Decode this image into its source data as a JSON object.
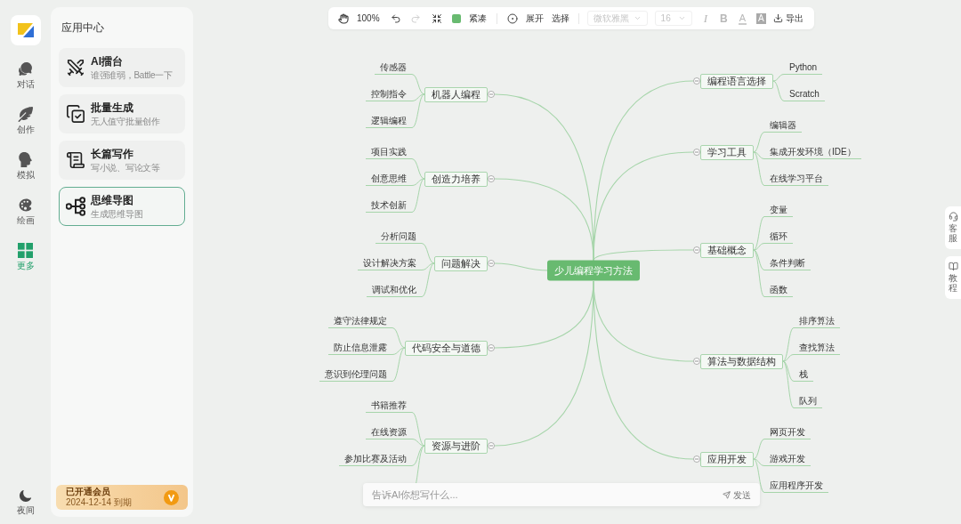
{
  "nav": {
    "items": [
      {
        "label": "对话",
        "selected": false
      },
      {
        "label": "创作",
        "selected": false
      },
      {
        "label": "模拟",
        "selected": false
      },
      {
        "label": "绘画",
        "selected": false
      },
      {
        "label": "更多",
        "selected": true
      }
    ],
    "night_mode": {
      "label": "夜间"
    }
  },
  "app_center": {
    "title": "应用中心",
    "apps": [
      {
        "title": "AI擂台",
        "subtitle": "谁强谁弱，Battle一下",
        "selected": false
      },
      {
        "title": "批量生成",
        "subtitle": "无人值守批量创作",
        "selected": false
      },
      {
        "title": "长篇写作",
        "subtitle": "写小说、写论文等",
        "selected": false
      },
      {
        "title": "思维导图",
        "subtitle": "生成思维导图",
        "selected": true
      }
    ],
    "membership": {
      "title": "已开通会员",
      "expiry": "2024-12-14 到期"
    }
  },
  "toolbar": {
    "zoom": "100%",
    "undo": {
      "disabled": false
    },
    "redo": {
      "disabled": true
    },
    "layout": "紧凑",
    "expand": "展开",
    "select": "选择",
    "font_family": {
      "value": "微软雅黑",
      "disabled": true
    },
    "font_size": {
      "value": "16",
      "disabled": true
    },
    "format_buttons": [
      {
        "kind": "italic",
        "label": "I",
        "disabled": true
      },
      {
        "kind": "bold",
        "label": "B",
        "disabled": true
      },
      {
        "kind": "font_color",
        "label": "A",
        "disabled": true
      },
      {
        "kind": "highlight",
        "label": "A",
        "disabled": true
      }
    ],
    "export": "导出"
  },
  "mind_map": {
    "root": "少儿编程学习方法",
    "left_branches": [
      {
        "label": "机器人编程",
        "expanded": true,
        "children": [
          {
            "label": "传感器"
          },
          {
            "label": "控制指令"
          },
          {
            "label": "逻辑编程"
          }
        ]
      },
      {
        "label": "创造力培养",
        "expanded": true,
        "children": [
          {
            "label": "项目实践"
          },
          {
            "label": "创意思维"
          },
          {
            "label": "技术创新"
          }
        ]
      },
      {
        "label": "问题解决",
        "expanded": true,
        "children": [
          {
            "label": "分析问题"
          },
          {
            "label": "设计解决方案"
          },
          {
            "label": "调试和优化"
          }
        ]
      },
      {
        "label": "代码安全与道德",
        "expanded": true,
        "children": [
          {
            "label": "遵守法律规定"
          },
          {
            "label": "防止信息泄露"
          },
          {
            "label": "意识到伦理问题"
          }
        ]
      },
      {
        "label": "资源与进阶",
        "expanded": true,
        "continues_below": true,
        "children": [
          {
            "label": "书籍推荐"
          },
          {
            "label": "在线资源"
          },
          {
            "label": "参加比赛及活动"
          }
        ]
      }
    ],
    "right_branches": [
      {
        "label": "编程语言选择",
        "expanded": true,
        "children": [
          {
            "label": "Python"
          },
          {
            "label": "Scratch"
          }
        ]
      },
      {
        "label": "学习工具",
        "expanded": true,
        "children": [
          {
            "label": "编辑器"
          },
          {
            "label": "集成开发环境（IDE）"
          },
          {
            "label": "在线学习平台"
          }
        ]
      },
      {
        "label": "基础概念",
        "expanded": true,
        "children": [
          {
            "label": "变量"
          },
          {
            "label": "循环"
          },
          {
            "label": "条件判断"
          },
          {
            "label": "函数"
          }
        ]
      },
      {
        "label": "算法与数据结构",
        "expanded": true,
        "children": [
          {
            "label": "排序算法"
          },
          {
            "label": "查找算法"
          },
          {
            "label": "栈"
          },
          {
            "label": "队列"
          }
        ]
      },
      {
        "label": "应用开发",
        "expanded": true,
        "children": [
          {
            "label": "网页开发"
          },
          {
            "label": "游戏开发"
          },
          {
            "label": "应用程序开发"
          }
        ]
      }
    ]
  },
  "prompt_bar": {
    "placeholder": "告诉AI你想写什么...",
    "send": "发送"
  },
  "side_tabs": [
    {
      "label": "客服"
    },
    {
      "label": "教程"
    }
  ]
}
